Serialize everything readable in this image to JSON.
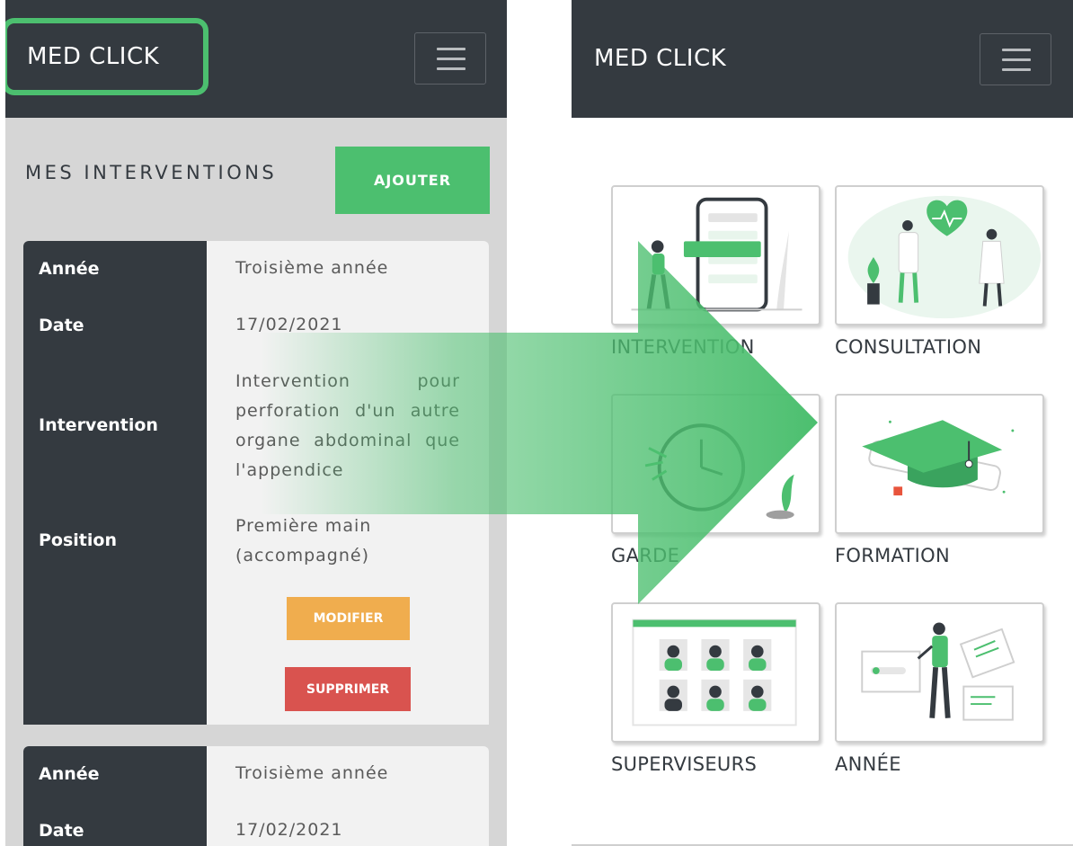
{
  "before_screen": {
    "navbar": {
      "brand": "MED CLICK",
      "menu_icon": "hamburger-menu-icon"
    },
    "section_title": "MES INTERVENTIONS",
    "add_button": "AJOUTER",
    "cards": [
      {
        "rows": [
          {
            "label": "Année",
            "value": "Troisième année"
          },
          {
            "label": "Date",
            "value": "17/02/2021"
          },
          {
            "label": "Intervention",
            "value": "Intervention pour perforation d'un autre organe abdominal que l'appendice"
          },
          {
            "label": "Position",
            "value": "Première main (accompagné)"
          }
        ],
        "modify_button": "MODIFIER",
        "delete_button": "SUPPRIMER"
      },
      {
        "rows": [
          {
            "label": "Année",
            "value": "Troisième année"
          },
          {
            "label": "Date",
            "value": "17/02/2021"
          }
        ]
      }
    ]
  },
  "after_screen": {
    "navbar": {
      "brand": "MED CLICK",
      "menu_icon": "hamburger-menu-icon"
    },
    "tiles": [
      {
        "label": "INTERVENTION",
        "icon": "phone-app-illustration"
      },
      {
        "label": "CONSULTATION",
        "icon": "doctors-heart-illustration"
      },
      {
        "label": "GARDE",
        "icon": "clock-illustration"
      },
      {
        "label": "FORMATION",
        "icon": "graduation-cap-illustration"
      },
      {
        "label": "SUPERVISEURS",
        "icon": "video-grid-illustration"
      },
      {
        "label": "ANNÉE",
        "icon": "presentation-illustration"
      }
    ]
  },
  "colors": {
    "navbar": "#343a40",
    "accent_green": "#4cbf6f",
    "modify_orange": "#f0ad4e",
    "delete_red": "#d9534f",
    "highlight_outline": "#4cbf6f"
  }
}
